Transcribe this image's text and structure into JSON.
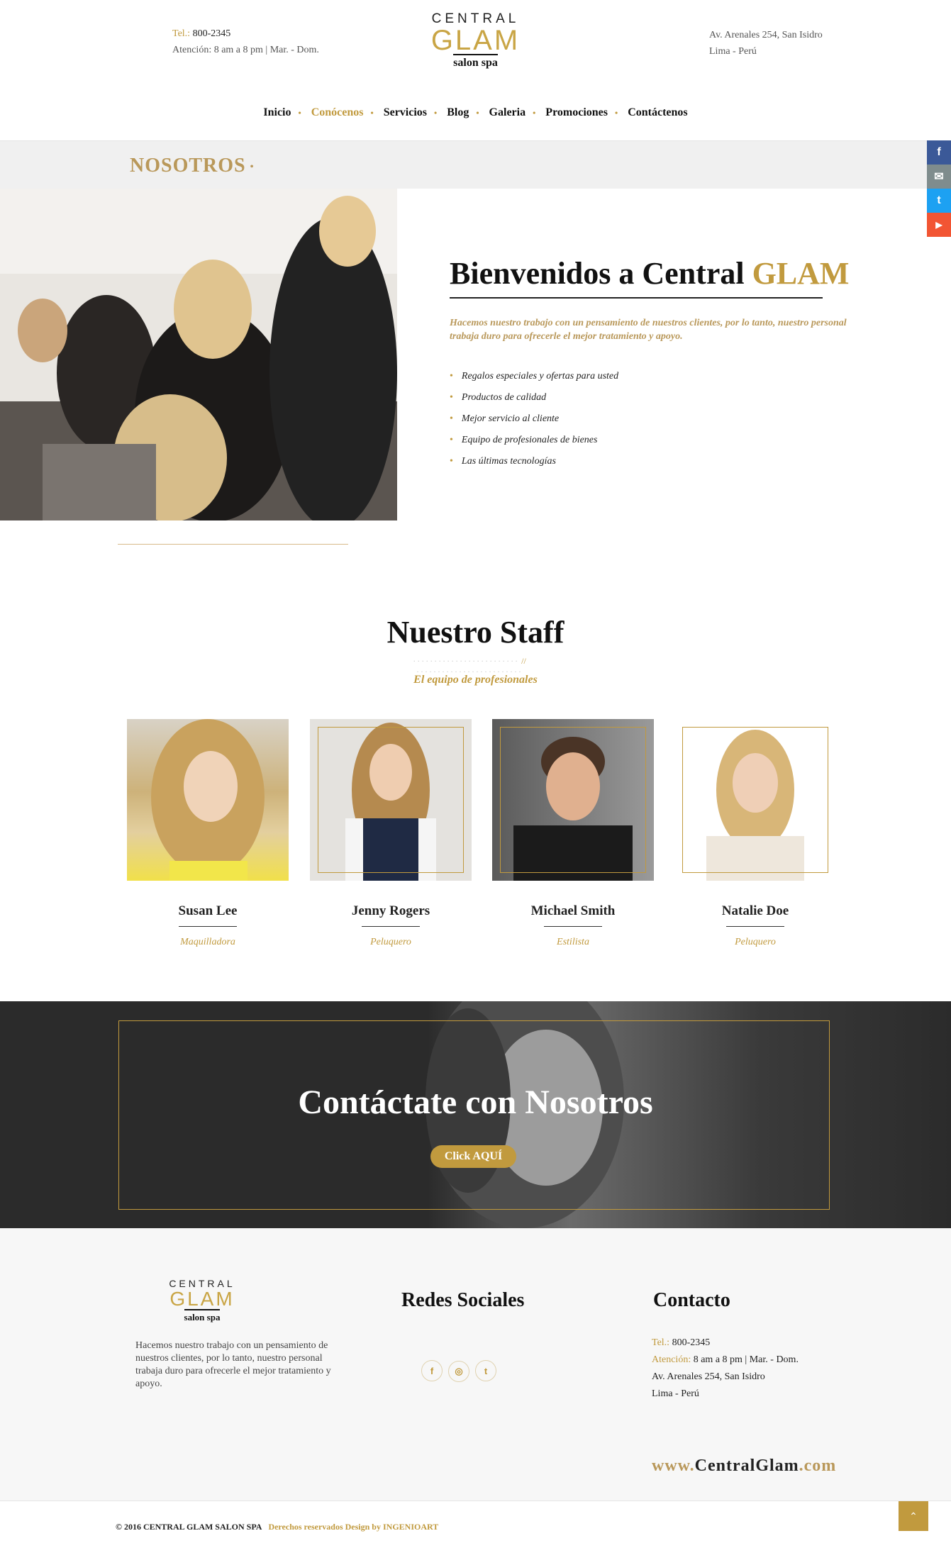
{
  "header": {
    "tel_label": "Tel.:",
    "tel_value": "800-2345",
    "hours": "Atención: 8 am a 8 pm  |  Mar. - Dom.",
    "logo_central": "CENTRAL",
    "logo_glam": "GLAM",
    "logo_spa": "salon spa",
    "address_line1": "Av. Arenales  254, San Isidro",
    "address_line2": "Lima - Perú"
  },
  "nav": {
    "items": [
      "Inicio",
      "Conócenos",
      "Servicios",
      "Blog",
      "Galeria",
      "Promociones",
      "Contáctenos"
    ],
    "active_index": 1
  },
  "section_bar": {
    "title": "NOSOTROS"
  },
  "social_sidebar": [
    {
      "icon": "facebook-icon",
      "glyph": "f",
      "color": "#3b5998"
    },
    {
      "icon": "email-icon",
      "glyph": "✉",
      "color": "#7f8c8d"
    },
    {
      "icon": "twitter-icon",
      "glyph": "t",
      "color": "#1da1f2"
    },
    {
      "icon": "youtube-icon",
      "glyph": "▶",
      "color": "#f25533"
    }
  ],
  "welcome": {
    "title_prefix": "Bienvenidos a Central ",
    "title_highlight": "GLAM",
    "intro": "Hacemos nuestro trabajo con un pensamiento de nuestros clientes, por lo tanto, nuestro personal trabaja duro para ofrecerle el mejor tratamiento y apoyo.",
    "features": [
      "Regalos especiales y ofertas para usted",
      "Productos de calidad",
      "Mejor servicio al cliente",
      "Equipo de profesionales de bienes",
      "Las últimas tecnologías"
    ]
  },
  "staff": {
    "title": "Nuestro Staff",
    "separator": "//",
    "subtitle": "El equipo de profesionales",
    "members": [
      {
        "name": "Susan Lee",
        "role": "Maquilladora"
      },
      {
        "name": "Jenny Rogers",
        "role": "Peluquero"
      },
      {
        "name": "Michael Smith",
        "role": "Estilista"
      },
      {
        "name": "Natalie Doe",
        "role": "Peluquero"
      }
    ]
  },
  "contact_band": {
    "title": "Contáctate con Nosotros",
    "button": "Click AQUÍ"
  },
  "footer": {
    "about": "Hacemos nuestro trabajo con un pensamiento de nuestros clientes, por lo tanto, nuestro personal trabaja duro para ofrecerle el mejor tratamiento y apoyo.",
    "social_title": "Redes Sociales",
    "social_icons": [
      {
        "icon": "facebook-icon",
        "glyph": "f"
      },
      {
        "icon": "instagram-icon",
        "glyph": "◎"
      },
      {
        "icon": "tumblr-icon",
        "glyph": "t"
      }
    ],
    "contact_title": "Contacto",
    "tel_label": "Tel.:",
    "tel_value": "800-2345",
    "hours_label": "Atención:",
    "hours_value": "8 am a 8 pm  |  Mar. - Dom.",
    "address_line1": "Av. Arenales  254, San Isidro",
    "address_line2": "Lima - Perú",
    "web_prefix": "www.",
    "web_main": "CentralGlam",
    "web_suffix": ".com"
  },
  "copyright": {
    "main": "© 2016   CENTRAL GLAM SALON SPA",
    "credit": "Derechos reservados Design by INGENIOART"
  },
  "colors": {
    "gold": "#c19a3e",
    "dark_band": "#2b2b2b",
    "footer_bg": "#f7f7f7"
  }
}
